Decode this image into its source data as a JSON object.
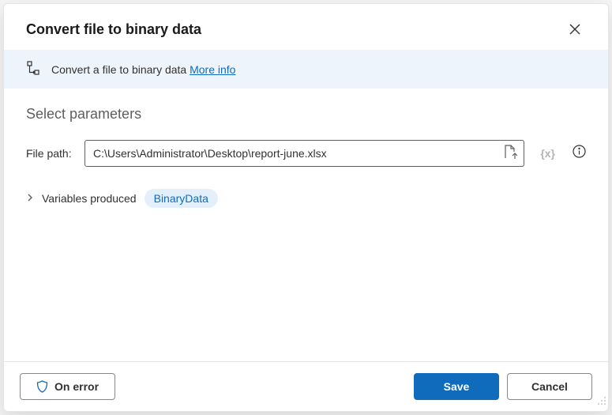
{
  "dialog": {
    "title": "Convert file to binary data"
  },
  "banner": {
    "text": "Convert a file to binary data ",
    "link": "More info"
  },
  "section": {
    "title": "Select parameters"
  },
  "field": {
    "label": "File path:",
    "value": "C:\\Users\\Administrator\\Desktop\\report-june.xlsx",
    "var_token": "{x}"
  },
  "variables": {
    "label": "Variables produced",
    "chip": "BinaryData"
  },
  "buttons": {
    "on_error": "On error",
    "save": "Save",
    "cancel": "Cancel"
  }
}
